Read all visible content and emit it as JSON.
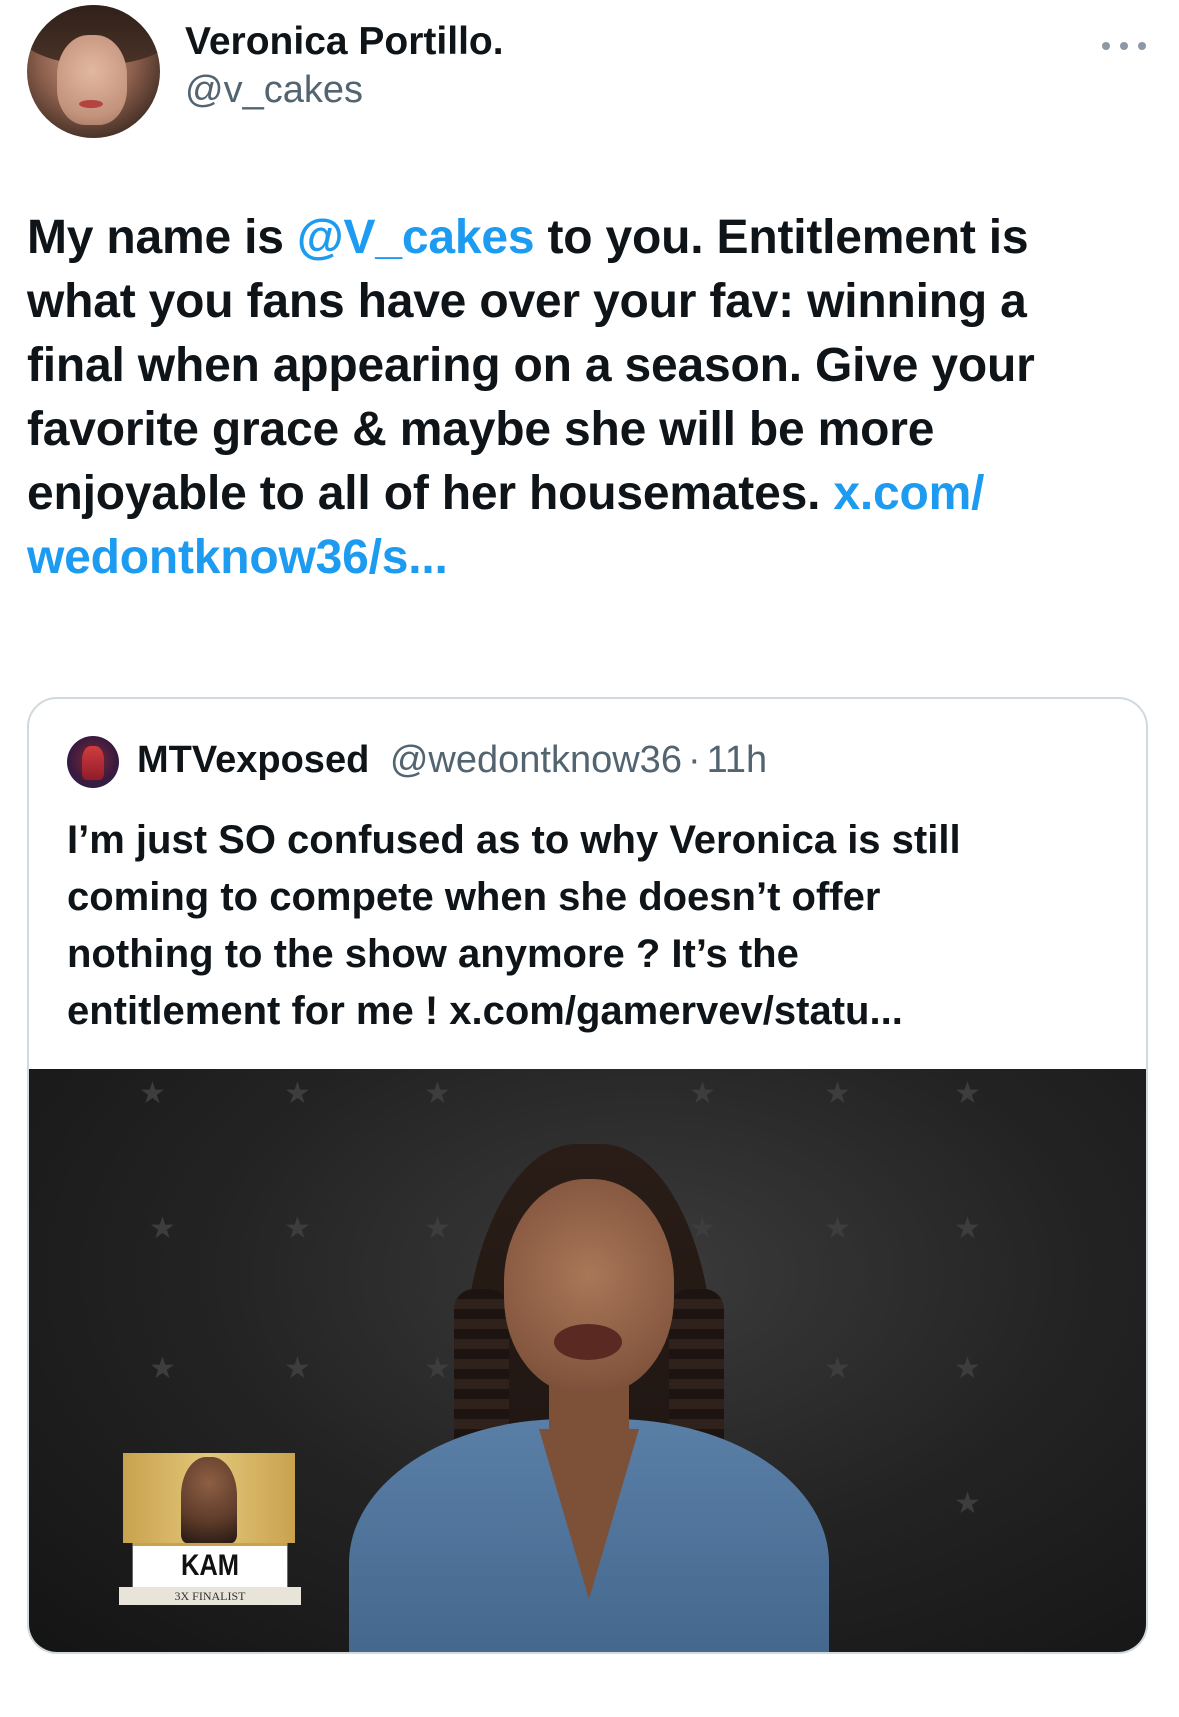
{
  "author": {
    "name": "Veronica Portillo.",
    "handle": "@v_cakes"
  },
  "tweet": {
    "lines": [
      [
        {
          "text": "My name is ",
          "link": false
        },
        {
          "text": "@V_cakes",
          "link": true
        },
        {
          "text": " to you.   Entitlement is",
          "link": false
        }
      ],
      [
        {
          "text": "what you fans have over your fav:  winning a",
          "link": false
        }
      ],
      [
        {
          "text": "final when appearing on a season.  Give your",
          "link": false
        }
      ],
      [
        {
          "text": "favorite grace & maybe she will be more",
          "link": false
        }
      ],
      [
        {
          "text": "enjoyable to all of her housemates. ",
          "link": false
        },
        {
          "text": "x.com/",
          "link": true
        }
      ],
      [
        {
          "text": "wedontknow36/s...",
          "link": true
        }
      ]
    ]
  },
  "quote": {
    "name": "MTVexposed",
    "handle": "@wedontknow36",
    "separator": "·",
    "time": "11h",
    "lines": [
      "I’m just SO confused as to why Veronica is still",
      "coming to compete when she doesn’t offer",
      "nothing to the show anymore ? It’s the",
      "entitlement for me ! x.com/gamervev/statu..."
    ],
    "media": {
      "lower_third_name": "KAM",
      "lower_third_subtitle": "3X FINALIST"
    }
  },
  "colors": {
    "link": "#1d9bf0",
    "secondary_text": "#536471",
    "border": "#cfd9de",
    "lower_third_gold": "#c9a24e"
  },
  "icons": {
    "more": "more-horizontal-icon"
  }
}
